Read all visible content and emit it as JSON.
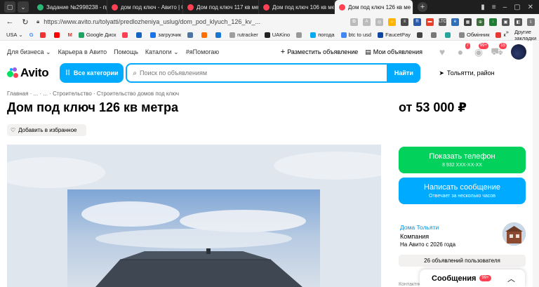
{
  "browser": {
    "tabs": [
      {
        "title": "Задание №2998238 - про",
        "fav_color": "#2bb673"
      },
      {
        "title": "дом под ключ - Авито | О",
        "fav_color": "#ff4053"
      },
      {
        "title": "Дом под ключ 117 кв мет",
        "fav_color": "#ff4053"
      },
      {
        "title": "Дом под ключ 106 кв мет",
        "fav_color": "#ff4053"
      },
      {
        "title": "Дом под ключ 126 кв ме",
        "fav_color": "#ff4053",
        "active": true
      }
    ],
    "url": "https://www.avito.ru/tolyatti/predlozheniya_uslug/dom_pod_klyuch_126_kv_...",
    "bookmarks": [
      "USA",
      "",
      "",
      "",
      "Google Диск",
      "",
      "",
      "загрузчик",
      "",
      "",
      "",
      "rutracker",
      "UAKino",
      "",
      "погода",
      "btc to usd",
      "FaucetPay",
      "",
      "",
      "",
      "Обмінник",
      "к"
    ],
    "other_bookmarks": "Другие закладки"
  },
  "topnav": {
    "business": "Для бизнеса",
    "career": "Карьера в Авито",
    "help": "Помощь",
    "catalogs": "Каталоги",
    "hashtag": "#яПомогаю",
    "post_ad": "Разместить объявление",
    "my_ads": "Мои объявления",
    "badges": {
      "notifications": "7",
      "messages": "99+",
      "cart": "15"
    }
  },
  "search": {
    "logo": "Avito",
    "categories": "Все категории",
    "placeholder": "Поиск по объявлениям",
    "find": "Найти",
    "location": "Тольятти, район"
  },
  "listing": {
    "breadcrumb": "Главная  ·  ...  ·  ...  ·  Строительство  ·  Строительство домов под ключ",
    "title": "Дом под ключ 126 кв метра",
    "price": "от 53 000 ₽",
    "favorite": "Добавить в избранное",
    "show_phone": "Показать телефон",
    "phone_masked": "8 932 XXX-XX-XX",
    "write_message": "Написать сообщение",
    "reply_note": "Отвечает за несколько часов"
  },
  "seller": {
    "name": "Дома Тольяти",
    "type": "Компания",
    "since": "На Авито с 2026 года",
    "ads_count": "26 объявлений пользователя",
    "contact_label": "Контактное лицо"
  },
  "messenger": {
    "label": "Сообщения",
    "count": "99+"
  },
  "colors": {
    "accent": "#00aaff",
    "green": "#02d15c",
    "red": "#ff4053"
  }
}
